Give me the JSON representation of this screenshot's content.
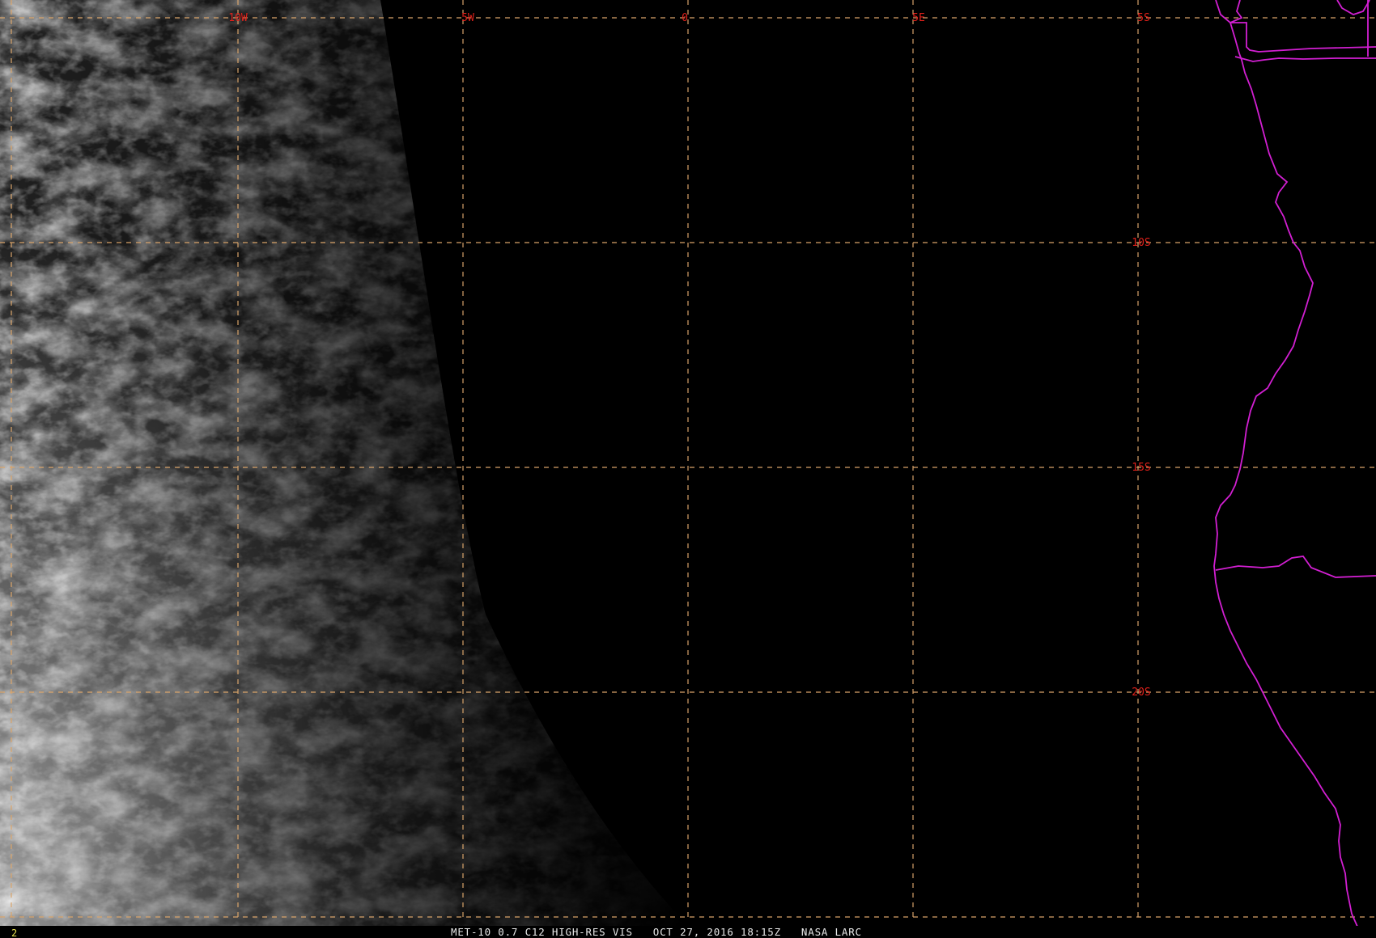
{
  "image": {
    "caption": "MET-10 0.7 C12 HIGH-RES VIS   OCT 27, 2016 18:15Z   NASA LARC",
    "frame_number": "2"
  },
  "grid": {
    "longitude_labels": [
      "10W",
      "5W",
      "0",
      "5E",
      "5S"
    ],
    "latitude_labels": [
      "10S",
      "15S",
      "20S"
    ]
  },
  "colors": {
    "background": "#000000",
    "gridline": "#d9a46a",
    "grid_label": "#e0201a",
    "coastline_border": "#d21fd2",
    "caption_text": "#e8e8e8",
    "frame_number": "#e8e050"
  }
}
